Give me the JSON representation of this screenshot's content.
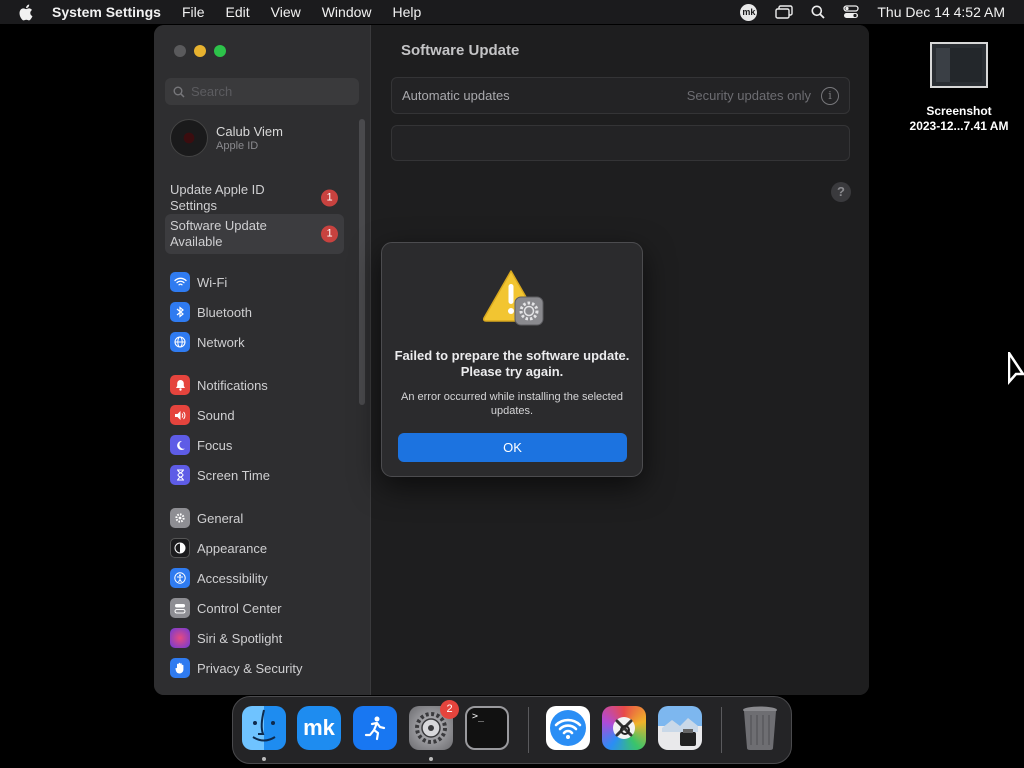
{
  "menubar": {
    "app_name": "System Settings",
    "menus": [
      "File",
      "Edit",
      "View",
      "Window",
      "Help"
    ],
    "clock": "Thu Dec 14  4:52 AM",
    "status_icons": [
      "mk-icon",
      "screen-mirroring-icon",
      "search-icon",
      "control-center-icon"
    ],
    "mk_label": "mk"
  },
  "desktop": {
    "file_name_line1": "Screenshot",
    "file_name_line2": "2023-12...7.41 AM"
  },
  "sidebar": {
    "search_placeholder": "Search",
    "account": {
      "name": "Calub Viem",
      "subtitle": "Apple ID"
    },
    "notices": [
      {
        "label": "Update Apple ID Settings",
        "badge": "1"
      },
      {
        "label": "Software Update Available",
        "badge": "1"
      }
    ],
    "items": [
      {
        "label": "Wi-Fi",
        "icon": "wifi-icon",
        "color": "#2f7bf0"
      },
      {
        "label": "Bluetooth",
        "icon": "bluetooth-icon",
        "color": "#2f7bf0"
      },
      {
        "label": "Network",
        "icon": "globe-icon",
        "color": "#2f7bf0"
      },
      {
        "label": "Notifications",
        "icon": "bell-icon",
        "color": "#e5443d"
      },
      {
        "label": "Sound",
        "icon": "speaker-icon",
        "color": "#e5443d"
      },
      {
        "label": "Focus",
        "icon": "moon-icon",
        "color": "#5e5ce6"
      },
      {
        "label": "Screen Time",
        "icon": "hourglass-icon",
        "color": "#5e5ce6"
      },
      {
        "label": "General",
        "icon": "gear-icon",
        "color": "#8e8e93"
      },
      {
        "label": "Appearance",
        "icon": "appearance-icon",
        "color": "#1c1c1e"
      },
      {
        "label": "Accessibility",
        "icon": "accessibility-icon",
        "color": "#2f7bf0"
      },
      {
        "label": "Control Center",
        "icon": "control-center-icon",
        "color": "#8e8e93"
      },
      {
        "label": "Siri & Spotlight",
        "icon": "siri-icon",
        "color": "#b04ad8"
      },
      {
        "label": "Privacy & Security",
        "icon": "hand-icon",
        "color": "#2f7bf0"
      }
    ]
  },
  "main": {
    "title": "Software Update",
    "auto_updates_label": "Automatic updates",
    "auto_updates_value": "Security updates only",
    "info_glyph": "i",
    "help_glyph": "?"
  },
  "dialog": {
    "title": "Failed to prepare the software update. Please try again.",
    "message": "An error occurred while installing the selected updates.",
    "ok_label": "OK"
  },
  "dock": {
    "apps": [
      {
        "name": "Finder",
        "icon": "finder-icon",
        "running": true
      },
      {
        "name": "mk",
        "icon": "mk-app-icon",
        "running": false
      },
      {
        "name": "Fitness",
        "icon": "runner-icon",
        "running": false
      },
      {
        "name": "System Settings",
        "icon": "settings-gear-icon",
        "running": true,
        "badge": "2"
      },
      {
        "name": "Terminal",
        "icon": "terminal-icon",
        "running": false
      },
      {
        "name": "Wi-Fi",
        "icon": "wifi-app-icon",
        "running": false
      },
      {
        "name": "Utility",
        "icon": "tools-icon",
        "running": false
      },
      {
        "name": "Preview",
        "icon": "preview-icon",
        "running": false
      },
      {
        "name": "Trash",
        "icon": "trash-icon",
        "running": false
      }
    ],
    "mk_label": "mk",
    "terminal_label": ">_"
  }
}
